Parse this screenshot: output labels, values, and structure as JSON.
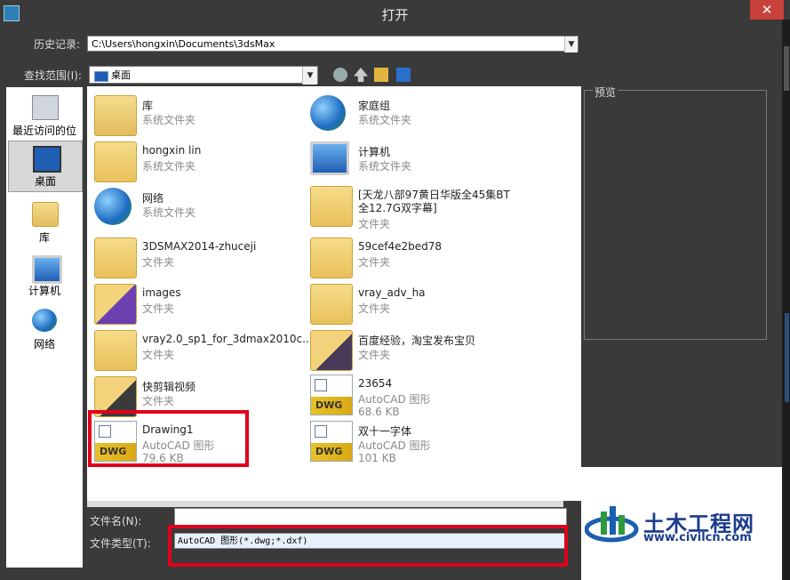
{
  "window": {
    "title": "打开",
    "close_glyph": "✕"
  },
  "history": {
    "label": "历史记录:",
    "value": "C:\\Users\\hongxin\\Documents\\3dsMax"
  },
  "lookin": {
    "label": "查找范围(I):",
    "value": "桌面"
  },
  "places": [
    {
      "label": "最近访问的位置",
      "icon": "recent-places-icon"
    },
    {
      "label": "桌面",
      "icon": "desktop-icon",
      "selected": true
    },
    {
      "label": "库",
      "icon": "library-icon"
    },
    {
      "label": "计算机",
      "icon": "computer-icon"
    },
    {
      "label": "网络",
      "icon": "network-icon"
    }
  ],
  "files": [
    {
      "name": "库",
      "type": "系统文件夹",
      "icon": "library-folder-icon"
    },
    {
      "name": "家庭组",
      "type": "系统文件夹",
      "icon": "homegroup-icon"
    },
    {
      "name": "hongxin lin",
      "type": "系统文件夹",
      "icon": "user-folder-icon"
    },
    {
      "name": "计算机",
      "type": "系统文件夹",
      "icon": "computer-icon"
    },
    {
      "name": "网络",
      "type": "系统文件夹",
      "icon": "network-icon"
    },
    {
      "name": "[天龙八部97黄日华版全45集BT全12.7G双字幕]",
      "type": "文件夹",
      "icon": "folder-icon"
    },
    {
      "name": "3DSMAX2014-zhuceji",
      "type": "文件夹",
      "icon": "folder-icon"
    },
    {
      "name": "59cef4e2bed78",
      "type": "文件夹",
      "icon": "folder-icon"
    },
    {
      "name": "images",
      "type": "文件夹",
      "icon": "folder-icon"
    },
    {
      "name": "vray_adv_ha",
      "type": "文件夹",
      "icon": "folder-icon"
    },
    {
      "name": "vray2.0_sp1_for_3dmax2010c...",
      "type": "文件夹",
      "icon": "folder-icon"
    },
    {
      "name": "百度经验，淘宝发布宝贝",
      "type": "文件夹",
      "icon": "folder-icon"
    },
    {
      "name": "快剪辑视频",
      "type": "文件夹",
      "icon": "folder-icon"
    },
    {
      "name": "23654",
      "type": "AutoCAD 图形",
      "size": "68.6 KB",
      "icon": "dwg-file-icon"
    },
    {
      "name": "Drawing1",
      "type": "AutoCAD 图形",
      "size": "79.6 KB",
      "icon": "dwg-file-icon"
    },
    {
      "name": "双十一字体",
      "type": "AutoCAD 图形",
      "size": "101 KB",
      "icon": "dwg-file-icon"
    }
  ],
  "dwg_badge": "DWG",
  "preview": {
    "label": "预览"
  },
  "filename": {
    "label": "文件名(N):",
    "value": ""
  },
  "filetype": {
    "label": "文件类型(T):",
    "value": "AutoCAD 图形(*.dwg;*.dxf)"
  },
  "watermark": {
    "title": "土木工程网",
    "url": "www.civilcn.com"
  },
  "colors": {
    "highlight_box": "#e1001a",
    "close_button": "#c8413a",
    "watermark_text": "#1b3c8c"
  }
}
